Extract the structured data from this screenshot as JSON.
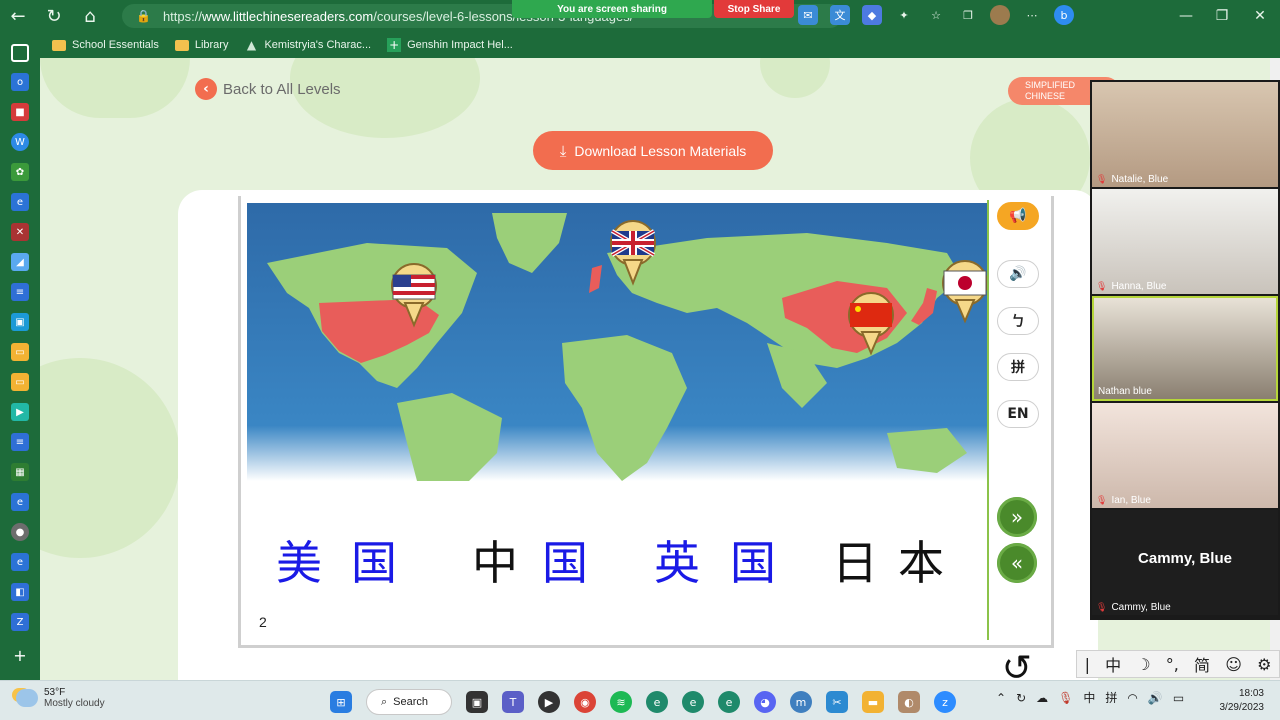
{
  "browser": {
    "url_prefix": "https://",
    "url_host": "www.littlechinesereaders.com",
    "url_path": "/courses/level-6-lessons/lesson-3-languages/",
    "screen_share_text": "You are screen sharing",
    "stop_share_label": "Stop Share",
    "bookmarks": [
      "School Essentials",
      "Library",
      "Kemistryia's Charac...",
      "Genshin Impact Hel..."
    ]
  },
  "page": {
    "back_label": "Back to All Levels",
    "lang_line1": "SIMPLIFIED",
    "lang_line2": "CHINESE",
    "download_label": "Download Lesson Materials",
    "page_number": "2"
  },
  "controls": {
    "pinyin_label": "拼",
    "en_label": "EN",
    "bopomofo_label": "ㄅ"
  },
  "words": [
    {
      "chars": [
        "美",
        "国"
      ],
      "colors": [
        "#1a1ae6",
        "#1a1ae6"
      ]
    },
    {
      "chars": [
        "中",
        "国"
      ],
      "colors": [
        "#111111",
        "#1a1ae6"
      ]
    },
    {
      "chars": [
        "英",
        "国"
      ],
      "colors": [
        "#1a1ae6",
        "#1a1ae6"
      ]
    },
    {
      "chars": [
        "日",
        "本"
      ],
      "colors": [
        "#111111",
        "#111111"
      ]
    }
  ],
  "participants": [
    {
      "name": "Natalie, Blue"
    },
    {
      "name": "Hanna, Blue"
    },
    {
      "name": "Nathan blue"
    },
    {
      "name": "Ian, Blue"
    },
    {
      "name": "Cammy, Blue",
      "big": "Cammy, Blue"
    }
  ],
  "ime": [
    "中",
    "简"
  ],
  "taskbar": {
    "temp": "53°F",
    "weather": "Mostly cloudy",
    "search_label": "Search",
    "time": "18:03",
    "date": "3/29/2023",
    "tray_lang": "中",
    "tray_ime": "拼"
  },
  "colors": {
    "accent": "#f26d4f",
    "green": "#4a8a2b",
    "chrome": "#1d6b3a"
  }
}
